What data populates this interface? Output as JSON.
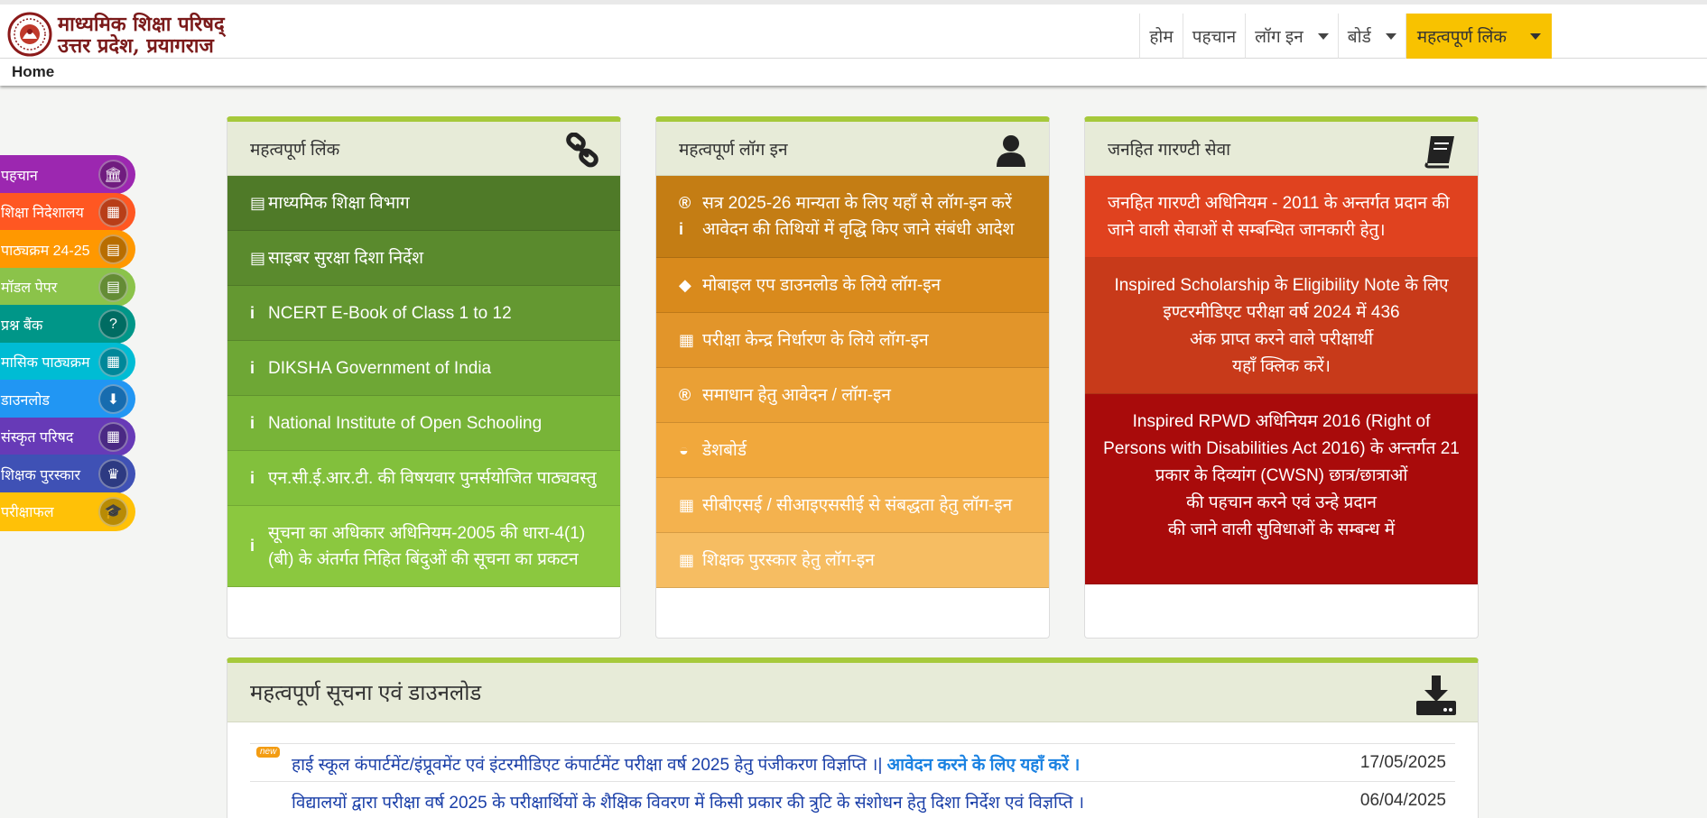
{
  "header": {
    "brand_line1": "माध्यमिक शिक्षा परिषद्",
    "brand_line2": "उत्तर प्रदेश, प्रयागराज",
    "nav": [
      {
        "label": "होम",
        "dropdown": false
      },
      {
        "label": "पहचान",
        "dropdown": false
      },
      {
        "label": "लॉग इन",
        "dropdown": true
      },
      {
        "label": "बोर्ड",
        "dropdown": true
      },
      {
        "label": "महत्वपूर्ण लिंक",
        "dropdown": true,
        "active": true
      }
    ],
    "active_color": "#f8c200"
  },
  "breadcrumb": {
    "home": "Home"
  },
  "sidebar": {
    "items": [
      {
        "label": "पहचान",
        "icon": "bank-icon",
        "color": "#9c27b0"
      },
      {
        "label": "शिक्षा निदेशालय",
        "icon": "building-icon",
        "color": "#ff5722"
      },
      {
        "label": "पाठ्यक्रम 24-25",
        "icon": "book-icon",
        "color": "#ff9800"
      },
      {
        "label": "मॉडल पेपर",
        "icon": "file-icon",
        "color": "#8bc34a"
      },
      {
        "label": "प्रश्न बैंक",
        "icon": "question-icon",
        "color": "#009688"
      },
      {
        "label": "मासिक पाठ्यक्रम",
        "icon": "calendar-icon",
        "color": "#00bcd4"
      },
      {
        "label": "डाउनलोड",
        "icon": "download-icon",
        "color": "#2196f3"
      },
      {
        "label": "संस्कृत परिषद",
        "icon": "building-icon",
        "color": "#673ab7"
      },
      {
        "label": "शिक्षक पुरस्कार",
        "icon": "trophy-icon",
        "color": "#3f51b5"
      },
      {
        "label": "परीक्षाफल",
        "icon": "graduation-cap-icon",
        "color": "#ffc107"
      }
    ]
  },
  "links_card": {
    "title": "महत्वपूर्ण लिंक",
    "icon": "link-icon",
    "items": [
      {
        "icon": "file-icon",
        "text": "माध्यमिक शिक्षा विभाग",
        "color": "#4f7a28"
      },
      {
        "icon": "file-icon",
        "text": "साइबर सुरक्षा दिशा निर्देश",
        "color": "#5a8a2d"
      },
      {
        "icon": "info-icon",
        "text": "NCERT E-Book of Class 1 to 12",
        "color": "#649831"
      },
      {
        "icon": "info-icon",
        "text": "DIKSHA Government of India",
        "color": "#6ea735"
      },
      {
        "icon": "info-icon",
        "text": "National Institute of Open Schooling",
        "color": "#78b438"
      },
      {
        "icon": "info-icon",
        "text": "एन.सी.ई.आर.टी. की विषयवार पुनर्सयोजित पाठ्यवस्तु",
        "color": "#82c03c"
      },
      {
        "icon": "info-icon",
        "text": "सूचना का अधिकार अधिनियम-2005 की धारा-4(1)(बी) के अंतर्गत निहित बिंदुओं की सूचना का प्रकटन",
        "color": "#8bc83f"
      }
    ]
  },
  "login_card": {
    "title": "महत्वपूर्ण लॉग इन",
    "icon": "user-icon",
    "items": [
      {
        "icons": [
          "registered-icon",
          "info-icon"
        ],
        "lines": [
          "सत्र 2025-26 मान्यता के लिए यहाँ से लॉग-इन करें",
          "आवेदन की तिथियों में वृद्धि किए जाने संबंधी आदेश"
        ],
        "color": "#c47d14"
      },
      {
        "icons": [
          "android-icon"
        ],
        "lines": [
          "मोबाइल एप डाउनलोड के लिये लॉग-इन"
        ],
        "color": "#d98a1c"
      },
      {
        "icons": [
          "building-icon"
        ],
        "lines": [
          "परीक्षा केन्द्र निर्धारण के लिये लॉग-इन"
        ],
        "color": "#e2952a"
      },
      {
        "icons": [
          "registered-icon"
        ],
        "lines": [
          "समाधान हेतु आवेदन / लॉग-इन"
        ],
        "color": "#eaa035"
      },
      {
        "icons": [
          "dashboard-icon"
        ],
        "lines": [
          "डेशबोर्ड"
        ],
        "color": "#f1a83c"
      },
      {
        "icons": [
          "building-icon"
        ],
        "lines": [
          "सीबीएसई / सीआइएससीई से संबद्धता हेतु लॉग-इन"
        ],
        "color": "#f4b24e"
      },
      {
        "icons": [
          "building-icon"
        ],
        "lines": [
          "शिक्षक पुरस्कार हेतु लॉग-इन"
        ],
        "color": "#f6bd62"
      }
    ]
  },
  "guarantee_card": {
    "title": "जनहित गारण्टी सेवा",
    "icon": "book-icon",
    "items": [
      {
        "lines": [
          "जनहित गारण्टी अधिनियम - 2011 के अन्तर्गत प्रदान की",
          "जाने वाली सेवाओं से सम्बन्धित जानकारी हेतु।"
        ],
        "color": "#e0421f",
        "align": "left"
      },
      {
        "lines": [
          "Inspired Scholarship के Eligibility Note के लिए",
          "इण्टरमीडिएट परीक्षा वर्ष 2024 में 436",
          "अंक प्राप्त करने वाले परीक्षार्थी",
          "यहाँ क्लिक करें।"
        ],
        "color": "#c83a1a",
        "align": "center"
      },
      {
        "lines": [
          "Inspired RPWD अधिनियम 2016 (Right of",
          "Persons with Disabilities Act 2016) के अन्तर्गत 21",
          "प्रकार के दिव्यांग (CWSN) छात्र/छात्राओं",
          "की पहचान करने एवं उन्हे प्रदान",
          "की जाने वाली सुविधाओं के सम्बन्ध में"
        ],
        "color": "#a90b0b",
        "align": "center"
      }
    ]
  },
  "notices": {
    "title": "महत्वपूर्ण सूचना एवं डाउनलोड",
    "icon": "download-icon",
    "new_badge": "new",
    "items": [
      {
        "text": "हाई स्कूल कंपार्टमेंट/इंप्रूवमेंट एवं इंटरमीडिएट कंपार्टमेंट परीक्षा वर्ष 2025 हेतु पंजीकरण विज्ञप्ति ।|",
        "link": " आवेदन करने के लिए यहाँ करें ।",
        "date": "17/05/2025",
        "is_new": true
      },
      {
        "text": "विद्यालयों द्वारा परीक्षा वर्ष 2025 के परीक्षार्थियों के शैक्षिक विवरण में किसी प्रकार की त्रुटि के संशोधन हेतु दिशा निर्देश एवं विज्ञप्ति ।",
        "link": "",
        "date": "06/04/2025",
        "is_new": false
      }
    ]
  }
}
